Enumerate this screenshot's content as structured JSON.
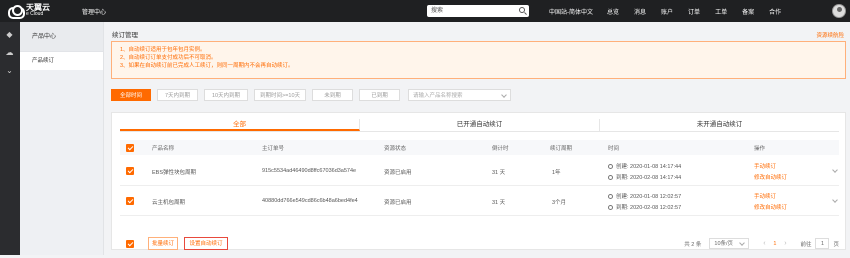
{
  "topbar": {
    "brand_cn": "天翼云",
    "brand_en": "e Cloud",
    "console": "管理中心",
    "search_placeholder": "搜索",
    "region": "中国站-简体中文",
    "nav": [
      "总览",
      "消息",
      "账户",
      "订单",
      "工单",
      "备案",
      "合作"
    ]
  },
  "subnav": {
    "title": "产品中心",
    "item": "产品续订"
  },
  "page": {
    "title": "续订管理",
    "help": "资源续航险"
  },
  "notice": {
    "lines": [
      "1、自动续订适用于包年包月实例。",
      "2、自动续订订单支付成功后不可取消。",
      "3、如果在自动续订前已完成人工续订，则同一周期内不会再自动续订。"
    ]
  },
  "filters": {
    "buttons": [
      "全部时间",
      "7天内到期",
      "10天内到期",
      "到期时间>=10天",
      "未到期",
      "已到期"
    ],
    "select_placeholder": "请输入产品名称搜索"
  },
  "tabs": [
    "全部",
    "已开通自动续订",
    "未开通自动续订"
  ],
  "table": {
    "headers": [
      "产品名称",
      "主订单号",
      "资源状态",
      "倒计时",
      "续订周期",
      "时间",
      "操作"
    ],
    "rows": [
      {
        "name": "EBS弹性块包周期",
        "order": "915c5534ad46490d8ffc67036d3a574e",
        "status": "资源已启用",
        "countdown": "31 天",
        "period": "1年",
        "created": "创建: 2020-01-08 14:17:44",
        "expires": "到期: 2020-02-08 14:17:44",
        "action1": "手动续订",
        "action2": "修改自动续订"
      },
      {
        "name": "云主机包周期",
        "order": "40880dd766e549cd86c6b48a6bed4fe4",
        "status": "资源已启用",
        "countdown": "31 天",
        "period": "3个月",
        "created": "创建: 2020-01-08 12:02:57",
        "expires": "到期: 2020-02-08 12:02:57",
        "action1": "手动续订",
        "action2": "修改自动续订"
      }
    ]
  },
  "footer": {
    "batch_renew": "批量续订",
    "set_auto": "设置自动续订",
    "total": "共 2 条",
    "page_size": "10条/页",
    "current_page": "1",
    "goto_label": "前往",
    "goto_value": "1",
    "page_unit": "页"
  }
}
